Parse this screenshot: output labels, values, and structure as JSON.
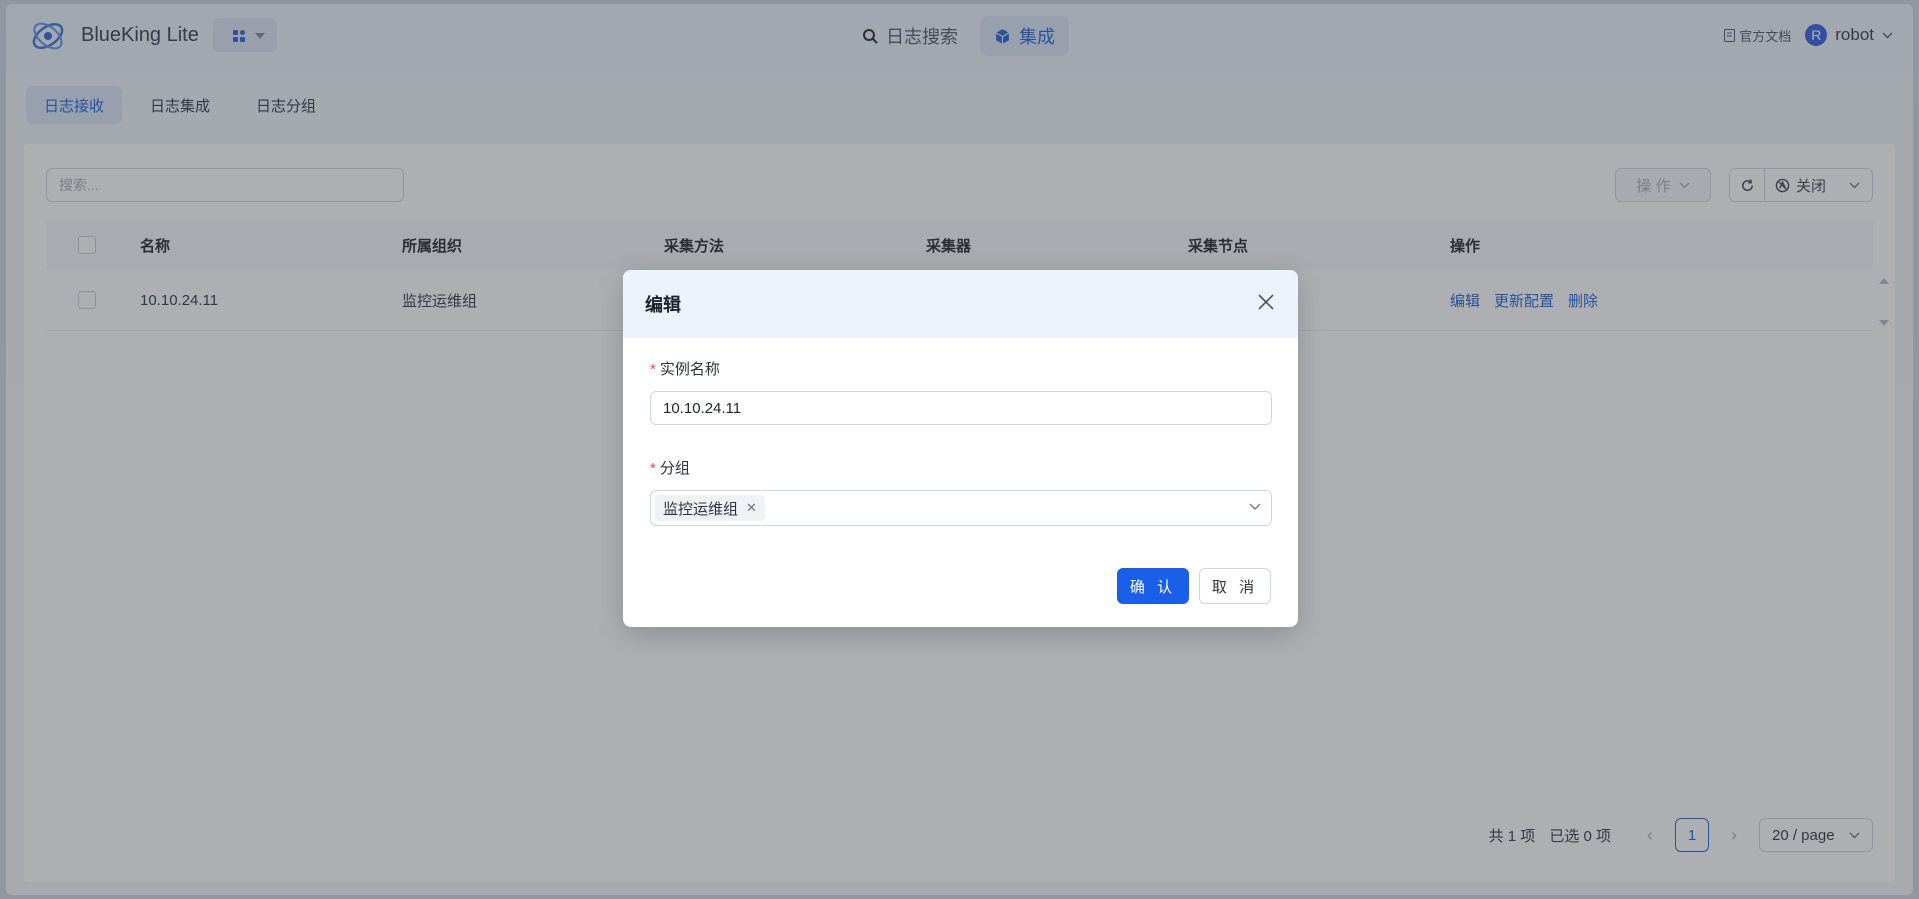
{
  "header": {
    "brand": "BlueKing Lite",
    "nav": [
      {
        "label": "日志搜索",
        "icon": "search-icon"
      },
      {
        "label": "集成",
        "icon": "cube-icon",
        "active": true
      }
    ],
    "docs_label": "官方文档",
    "user": {
      "avatar_letter": "R",
      "name": "robot"
    }
  },
  "subtabs": [
    {
      "label": "日志接收",
      "active": true
    },
    {
      "label": "日志集成"
    },
    {
      "label": "日志分组"
    }
  ],
  "toolbar": {
    "search_placeholder": "搜索...",
    "action_label": "操 作",
    "auto_refresh_label": "关闭"
  },
  "table": {
    "columns": [
      "名称",
      "所属组织",
      "采集方法",
      "采集器",
      "采集节点",
      "操作"
    ],
    "rows": [
      {
        "name": "10.10.24.11",
        "org": "监控运维组"
      }
    ],
    "row_actions": [
      "编辑",
      "更新配置",
      "删除"
    ]
  },
  "pagination": {
    "total": "共 1 项",
    "selected": "已选 0 项",
    "current_page": "1",
    "page_size": "20 / page"
  },
  "modal": {
    "title": "编辑",
    "fields": {
      "instance_name_label": "实例名称",
      "instance_name_value": "10.10.24.11",
      "group_label": "分组",
      "group_tag": "监控运维组"
    },
    "confirm_label": "确 认",
    "cancel_label": "取 消"
  },
  "colors": {
    "primary": "#1a5fe8",
    "required": "#e5484d"
  }
}
